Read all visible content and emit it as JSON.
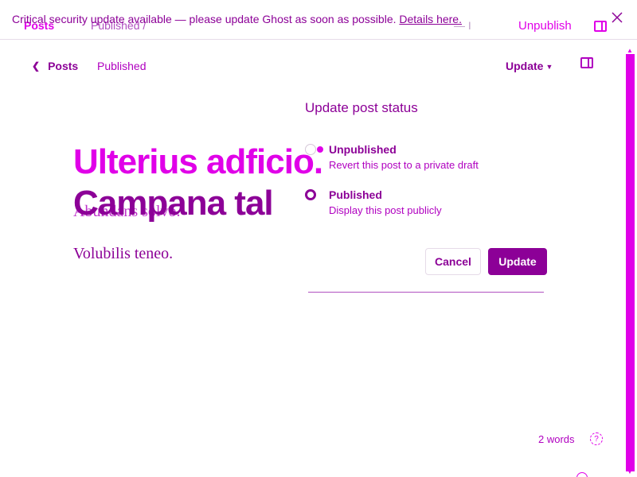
{
  "banner": {
    "text": "Critical security update available — please update Ghost as soon as possible. ",
    "link": "Details here."
  },
  "ghost": {
    "posts": "Posts",
    "published": "Published /",
    "unpublish": "Unpublish",
    "dash": "— I"
  },
  "header": {
    "back_label": "Posts",
    "status": "Published",
    "update_label": "Update"
  },
  "post": {
    "title": "Ulterius adficio.",
    "title_second": "Campana tal",
    "subtitle": "Abundans solvo.",
    "body": "Volubilis teneo."
  },
  "popover": {
    "title": "Update post status",
    "options": [
      {
        "label": "Unpublished",
        "description": "Revert this post to a private draft",
        "selected": false
      },
      {
        "label": "Published",
        "description": "Display this post publicly",
        "selected": true
      }
    ],
    "cancel_label": "Cancel",
    "update_label": "Update"
  },
  "footer": {
    "word_count": "2 words",
    "help": "?"
  },
  "colors": {
    "accent": "#8c0097",
    "highlight": "#e000e8"
  }
}
